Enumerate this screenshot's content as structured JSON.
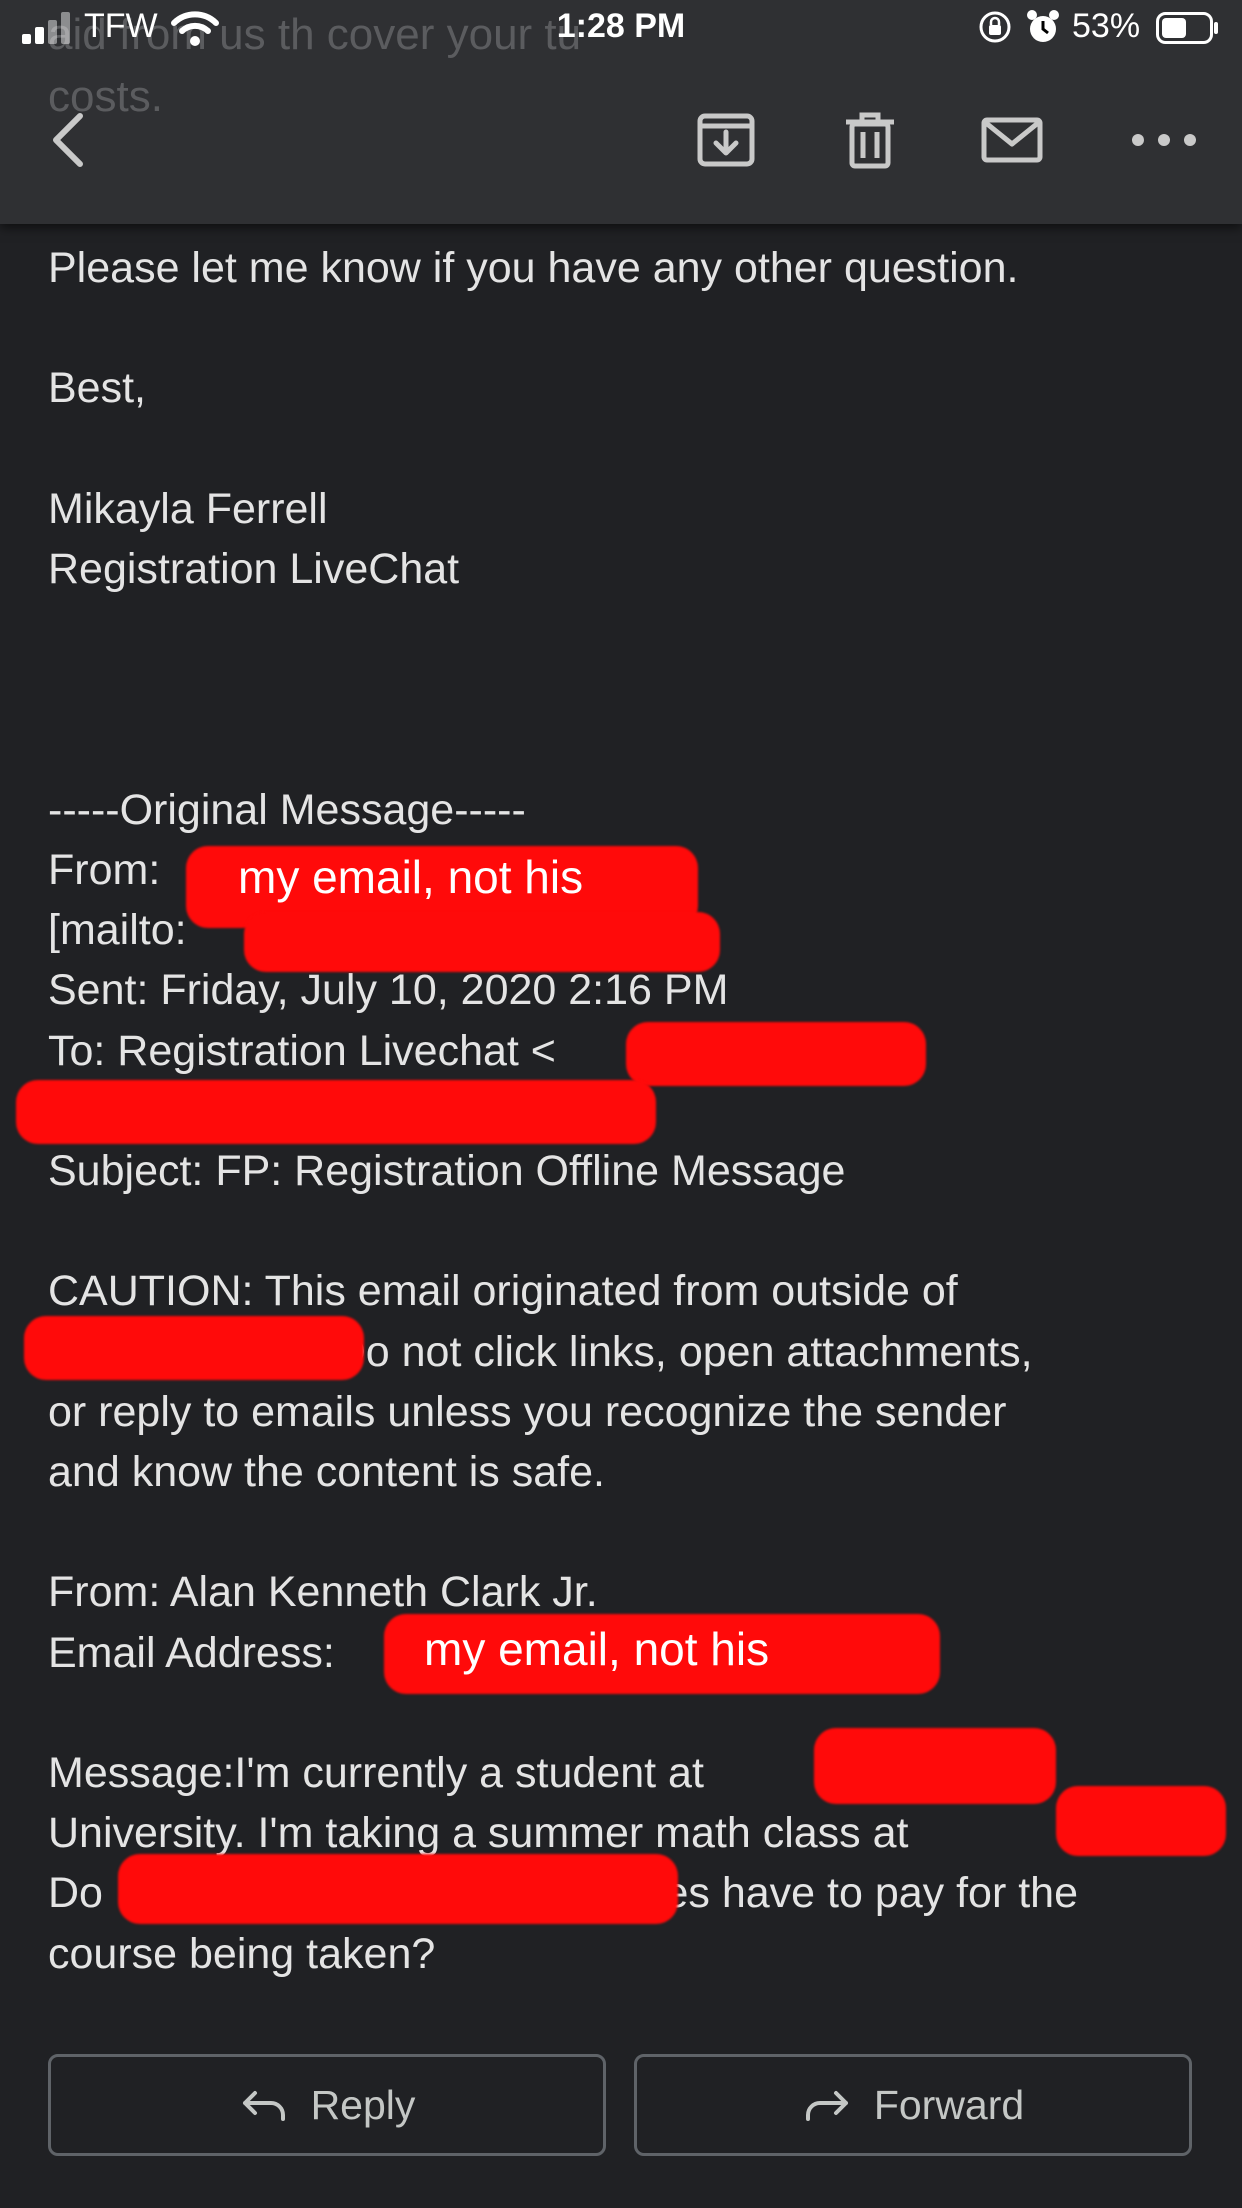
{
  "status_bar": {
    "carrier": "TFW",
    "time": "1:28 PM",
    "battery_percent": "53%",
    "battery_level": 0.53
  },
  "scrolled_under_text": "aid from us th        cover your tu",
  "scrolled_under_text_2": "costs.",
  "toolbar": {
    "icons": [
      "back-icon",
      "archive-icon",
      "trash-icon",
      "mark-unread-icon",
      "more-icon"
    ]
  },
  "email": {
    "lines": [
      "Please let me know if you have any other question.",
      "",
      "Best,",
      "",
      "Mikayla Ferrell",
      "Registration LiveChat",
      "",
      "",
      "",
      "-----Original Message-----",
      "From: ",
      "[mailto:                                  ]",
      "Sent: Friday, July 10, 2020 2:16 PM",
      "To: Registration Livechat <",
      "",
      "Subject: FP: Registration Offline Message",
      "",
      "CAUTION: This email originated from outside of",
      "                      . Do not click links, open attachments,",
      "or reply to emails unless you recognize the sender",
      "and know the content is safe.",
      "",
      "From: Alan Kenneth Clark Jr.",
      "Email Address: ",
      "",
      "Message:I'm currently a student at",
      "University. I'm taking a summer math class at",
      "Do                                               es have to pay for the",
      "course being taken?"
    ]
  },
  "annotations": {
    "from_note": "my email, not his",
    "email_address_note": "my email, not his"
  },
  "actions": {
    "reply_label": "Reply",
    "forward_label": "Forward"
  },
  "colors": {
    "background": "#202124",
    "toolbar": "#2f3033",
    "text": "#e4e4e4",
    "redaction": "#ff0a0a",
    "button_border": "#5f6368"
  }
}
